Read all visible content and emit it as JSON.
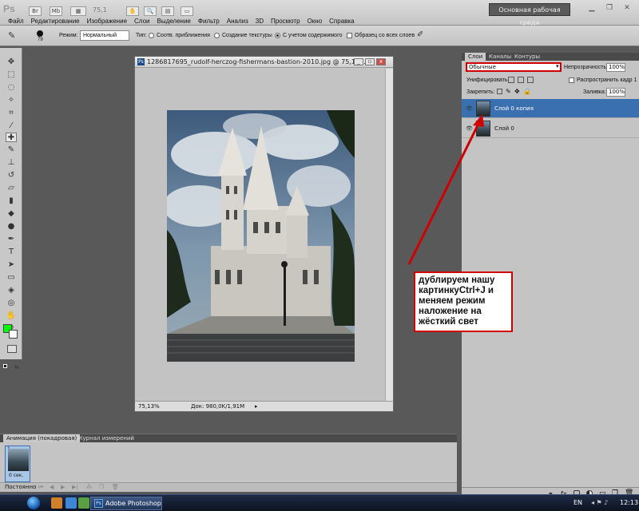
{
  "menubar": {
    "logo": "Ps",
    "btn_br": "Br",
    "btn_mb": "Mb",
    "zoom": "75,1",
    "items": [
      "Файл",
      "Редактирование",
      "Изображение",
      "Слои",
      "Выделение",
      "Фильтр",
      "Анализ",
      "3D",
      "Просмотр",
      "Окно",
      "Справка"
    ],
    "workspace": "Основная рабочая среда"
  },
  "options": {
    "brush_size": "79",
    "mode_label": "Режим:",
    "mode_value": "Нормальный",
    "type_label": "Тип:",
    "type_opt1": "Соотв. приближения",
    "type_opt2": "Создание текстуры",
    "type_opt3": "С учетом содержимого",
    "sample_all": "Образец со всех слоев"
  },
  "document": {
    "title": "1286817695_rudolf-herczog-fishermans-bastion-2010.jpg @ 75,1%...",
    "zoom": "75,13%",
    "doc_size": "Док: 980,0K/1,91M"
  },
  "layers_panel": {
    "tabs": [
      "Слои",
      "Каналы",
      "Контуры"
    ],
    "blend_mode": "Обычные",
    "opacity_label": "Непрозрачность:",
    "opacity_value": "100%",
    "unify_label": "Унифицировать:",
    "propagate_label": "Распространить кадр 1",
    "lock_label": "Закрепить:",
    "fill_label": "Заливка:",
    "fill_value": "100%",
    "layers": [
      {
        "name": "Слой 0 копия",
        "selected": true
      },
      {
        "name": "Слой 0",
        "selected": false
      }
    ]
  },
  "animation_panel": {
    "tabs": [
      "Анимация (покадровая)",
      "Журнал измерений"
    ],
    "frame_number": "1",
    "frame_duration": "0 сек.",
    "loop": "Постоянно"
  },
  "taskbar": {
    "task_label": "Adobe Photoshop ...",
    "lang": "EN",
    "clock": "12:13"
  },
  "annotation": {
    "text": "дублируем нашу картинкуCtrl+J и меняем режим наложение на жёсткий свет"
  },
  "colors": {
    "foreground": "#00ff00",
    "background": "#ffffff",
    "annotation_border": "#d00000",
    "selection": "#3a6fb0"
  }
}
